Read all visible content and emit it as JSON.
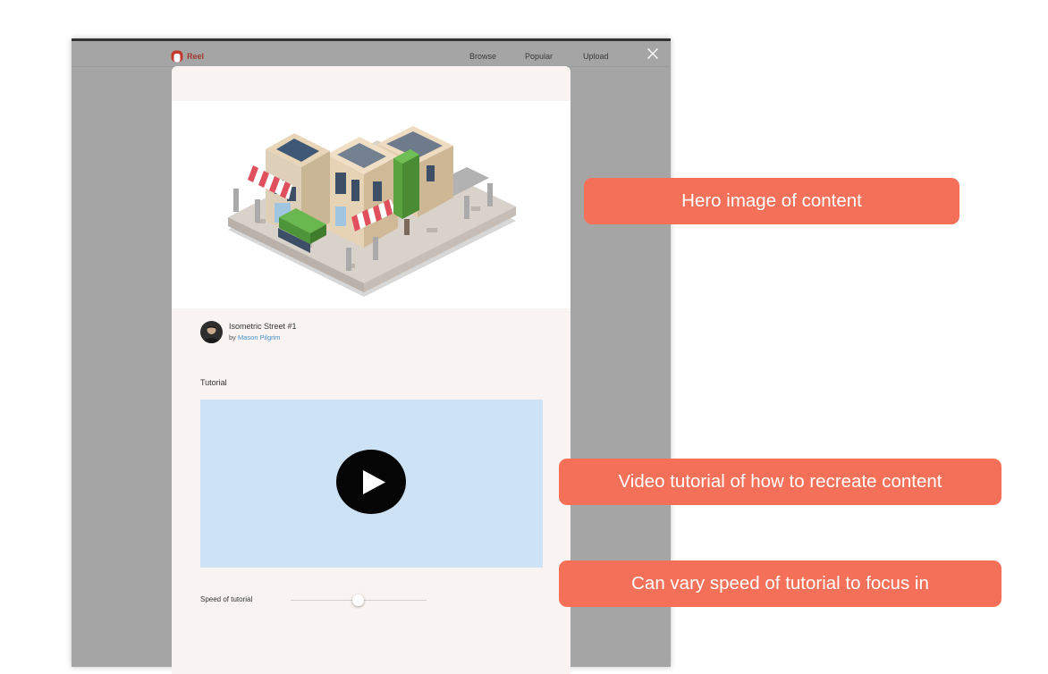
{
  "app": {
    "brand_name": "Reel",
    "brand_color": "#a03a2e",
    "nav": [
      {
        "label": "Browse"
      },
      {
        "label": "Popular"
      },
      {
        "label": "Upload"
      }
    ],
    "close_icon": "close-icon"
  },
  "content": {
    "title": "Isometric Street #1",
    "author_prefix": "by",
    "author_name": "Mason Pilgrim",
    "hero_image": "isometric-street-illustration"
  },
  "tutorial": {
    "heading": "Tutorial",
    "play_icon": "play-icon",
    "speed_label": "Speed of tutorial",
    "speed_value": 0.5
  },
  "annotations": {
    "hero": "Hero image of content",
    "video": "Video tutorial of how to recreate content",
    "speed": "Can vary speed of tutorial to focus in"
  },
  "colors": {
    "callout": "#f47058",
    "video_bg": "#cde2f5",
    "modal_bg": "#f9f4f1",
    "link": "#4a90c8"
  }
}
